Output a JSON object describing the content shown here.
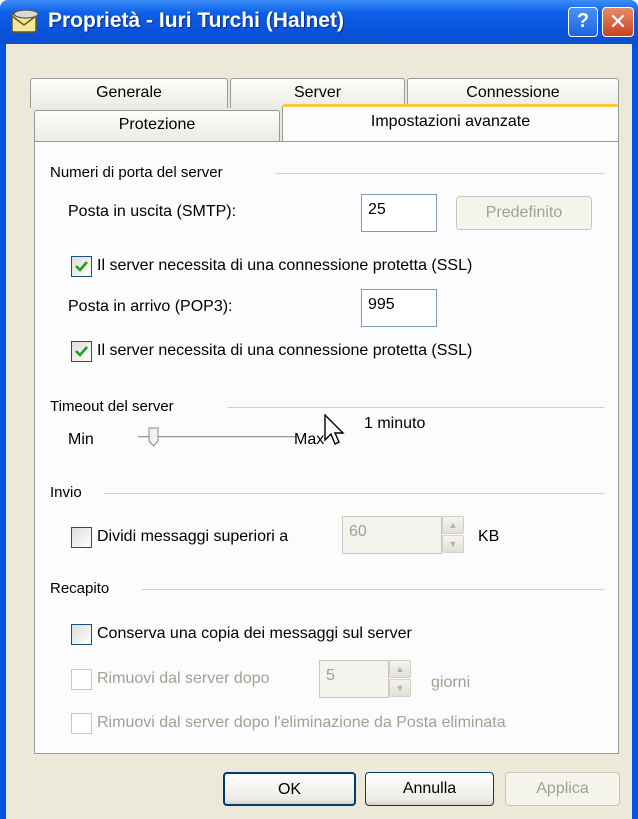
{
  "window": {
    "title": "Proprietà - Iuri Turchi (Halnet)",
    "help_label": "?",
    "close_label": "✕"
  },
  "tabs": {
    "row1": [
      {
        "label": "Generale"
      },
      {
        "label": "Server"
      },
      {
        "label": "Connessione"
      }
    ],
    "row2": [
      {
        "label": "Protezione"
      },
      {
        "label": "Impostazioni avanzate",
        "active": true
      }
    ]
  },
  "ports": {
    "group_label": "Numeri di porta del server",
    "smtp_label": "Posta in uscita (SMTP):",
    "smtp_value": "25",
    "default_button": "Predefinito",
    "smtp_ssl_label": "Il server necessita di una connessione protetta (SSL)",
    "smtp_ssl_checked": true,
    "pop3_label": "Posta in arrivo (POP3):",
    "pop3_value": "995",
    "pop3_ssl_label": "Il server necessita di una connessione protetta (SSL)",
    "pop3_ssl_checked": true
  },
  "timeout": {
    "group_label": "Timeout del server",
    "min_label": "Min",
    "max_label": "Max",
    "value_label": "1 minuto",
    "slider_fraction": 0.1
  },
  "sending": {
    "group_label": "Invio",
    "split_label": "Dividi messaggi superiori a",
    "split_checked": false,
    "split_value": "60",
    "unit": "KB"
  },
  "delivery": {
    "group_label": "Recapito",
    "keep_copy_label": "Conserva una copia dei messaggi sul server",
    "keep_copy_checked": false,
    "remove_after_label": "Rimuovi dal server dopo",
    "remove_after_value": "5",
    "days_unit": "giorni",
    "remove_deleted_label": "Rimuovi dal server dopo l'eliminazione da Posta eliminata"
  },
  "footer": {
    "ok": "OK",
    "cancel": "Annulla",
    "apply": "Applica"
  },
  "colors": {
    "titlebar": "#0a52dc",
    "tab_highlight": "#ffc83c",
    "check": "#21a121"
  }
}
